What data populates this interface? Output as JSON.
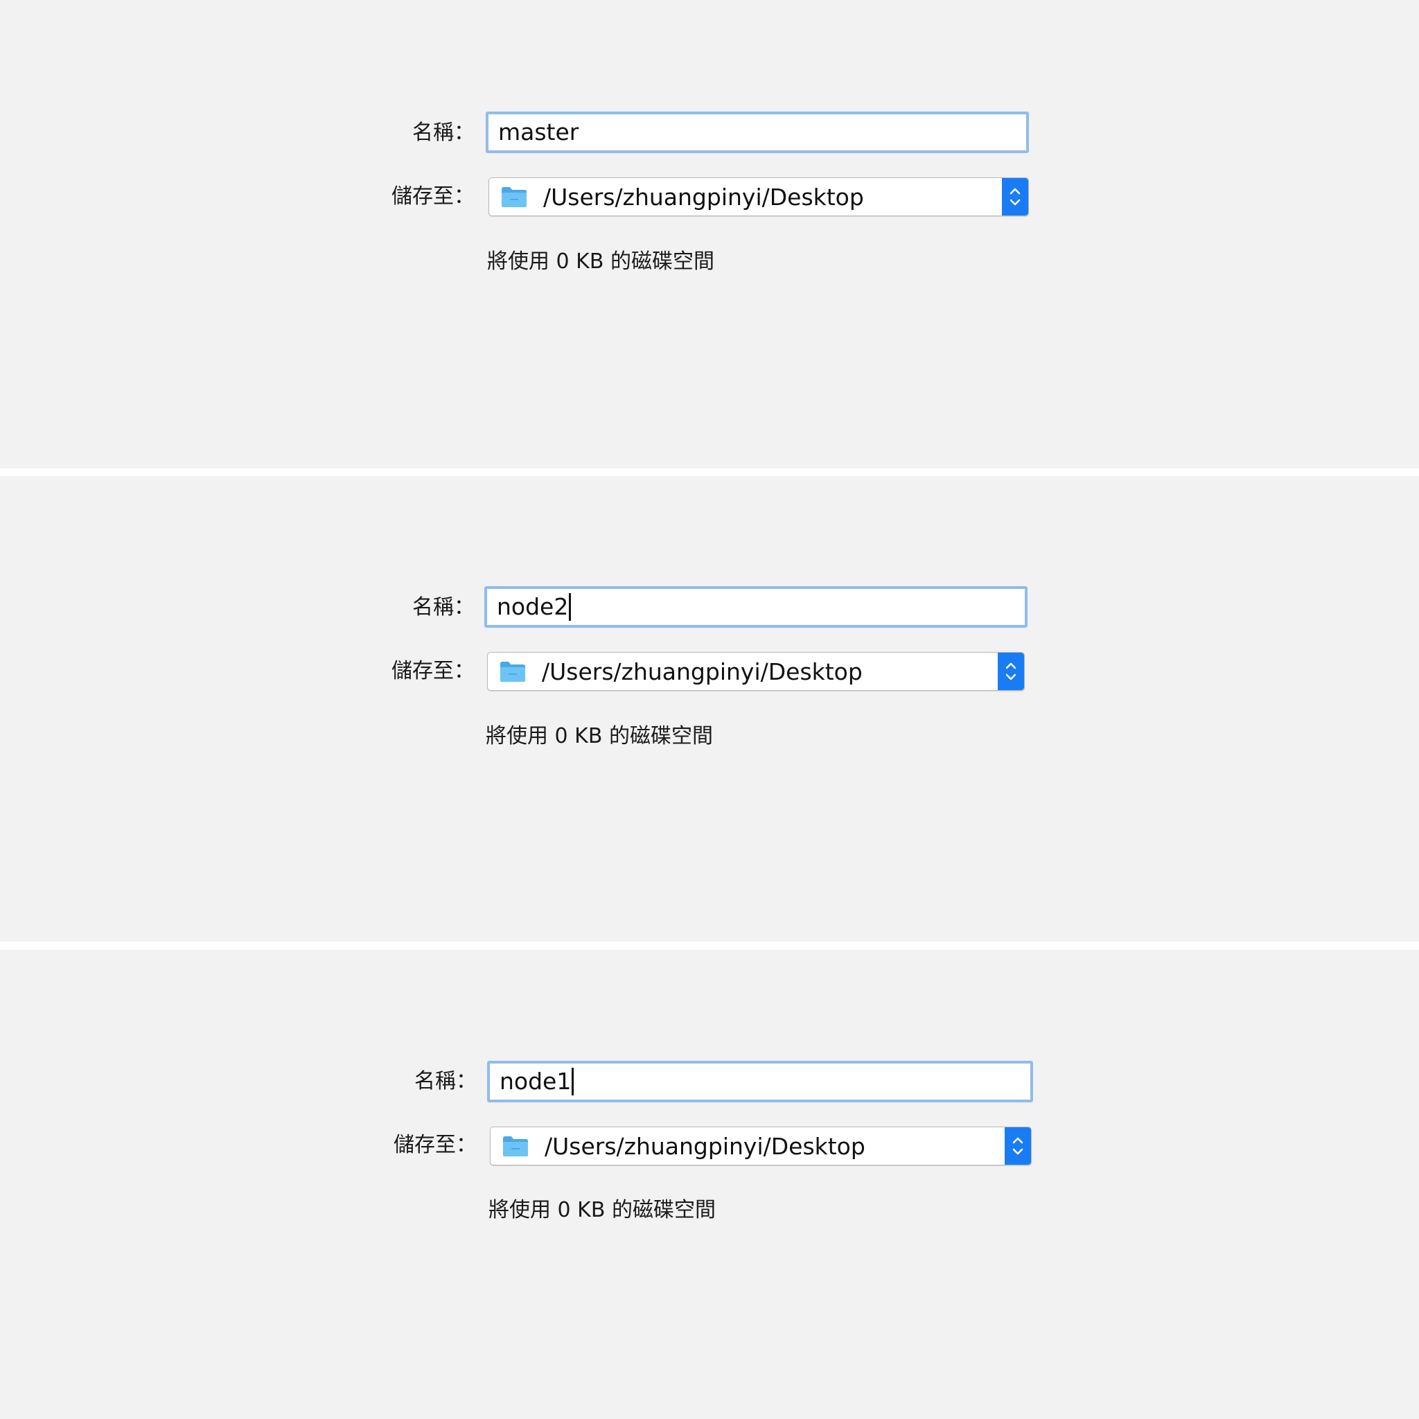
{
  "colors": {
    "panel_background": "#f2f2f2",
    "focus_ring": "#8fbcee",
    "stepper_accent": "#1a7cf4",
    "folder": "#5ab8ee"
  },
  "dialogs": [
    {
      "name_label": "名稱：",
      "name_value": "master",
      "caret_visible": false,
      "save_label": "儲存至：",
      "save_path": "/Users/zhuangpinyi/Desktop",
      "folder_icon": "folder-icon",
      "disk_usage": "將使用 0 KB 的磁碟空間"
    },
    {
      "name_label": "名稱：",
      "name_value": "node2",
      "caret_visible": true,
      "save_label": "儲存至：",
      "save_path": "/Users/zhuangpinyi/Desktop",
      "folder_icon": "folder-icon",
      "disk_usage": "將使用 0 KB 的磁碟空間"
    },
    {
      "name_label": "名稱：",
      "name_value": "node1",
      "caret_visible": true,
      "save_label": "儲存至：",
      "save_path": "/Users/zhuangpinyi/Desktop",
      "folder_icon": "folder-icon",
      "disk_usage": "將使用 0 KB 的磁碟空間"
    }
  ]
}
